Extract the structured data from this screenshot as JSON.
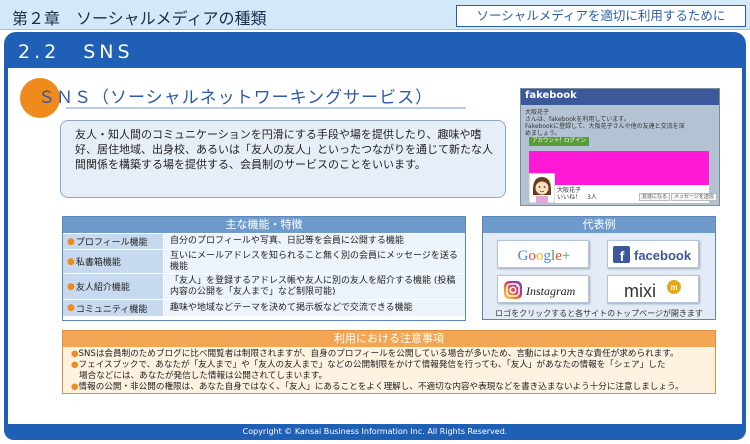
{
  "header": {
    "chapter_title": "第２章　ソーシャルメディアの種類",
    "nav_link": "ソーシャルメディアを適切に利用するために"
  },
  "section": {
    "title": "2.2　SNS"
  },
  "topic": {
    "title": "ＳＮＳ（ソーシャルネットワーキングサービス）",
    "description": "友人・知人間のコミュニケーションを円滑にする手段や場を提供したり、趣味や嗜好、居住地域、出身校、あるいは「友人の友人」といったつながりを通じて新たな人間関係を構築する場を提供する、会員制のサービスのことをいいます。"
  },
  "screenshot": {
    "logo": "fakebook",
    "name_line": "大阪花子",
    "text_line1": "さんは、fakebookを利用しています。",
    "text_line2": "Fakebookに登録して、大阪花子さんや他の友達と交流を深",
    "text_line3": "めましょう。",
    "btn_register": "アカウント登録",
    "btn_login": "ログイン",
    "profile_name": "大阪花子",
    "profile_likes": "いいね！　3人",
    "mini_btn1": "友達になる",
    "mini_btn2": "メッセージを送信"
  },
  "features": {
    "header": "主な機能・特徴",
    "rows": [
      {
        "name": "プロフィール機能",
        "desc": "自分のプロフィールや写真、日記等を会員に公開する機能"
      },
      {
        "name": "私書箱機能",
        "desc": "互いにメールアドレスを知られること無く別の会員にメッセージを送る機能"
      },
      {
        "name": "友人紹介機能",
        "desc": "「友人」を登録するアドレス帳や友人に別の友人を紹介する機能 (投稿内容の公開を「友人まで」など制限可能)"
      },
      {
        "name": "コミュニティ機能",
        "desc": "趣味や地域などテーマを決めて掲示板などで交流できる機能"
      }
    ]
  },
  "representatives": {
    "header": "代表例",
    "logos": [
      "Google+",
      "facebook",
      "Instagram",
      "mixi"
    ],
    "note": "ロゴをクリックすると各サイトのトップページが開きます"
  },
  "caution": {
    "header": "利用における注意事項",
    "line1": "SNSは会員制のためブログに比べ閲覧者は制限されますが、自身のプロフィールを公開している場合が多いため、言動にはより大きな責任が求められます。",
    "line2": "フェイスブックで、あなたが「友人まで」や「友人の友人まで」などの公開制限をかけて情報発信を行っても、「友人」があなたの情報を「シェア」した",
    "line2b": "場合などには、あなたが発信した情報は公開されてしまいます。",
    "line3": "情報の公開・非公開の権限は、あなた自身ではなく、「友人」にあることをよく理解し、不適切な内容や表現などを書き込まないよう十分に注意しましょう。"
  },
  "footer": {
    "text": "Copyright ©  Kansai Business Information Inc.  All Rights Reserved."
  },
  "colors": {
    "primary_blue": "#1f5fb6",
    "accent_orange": "#f08a1c",
    "caution_orange": "#f2a653",
    "fakebook_blue": "#3b5998"
  }
}
